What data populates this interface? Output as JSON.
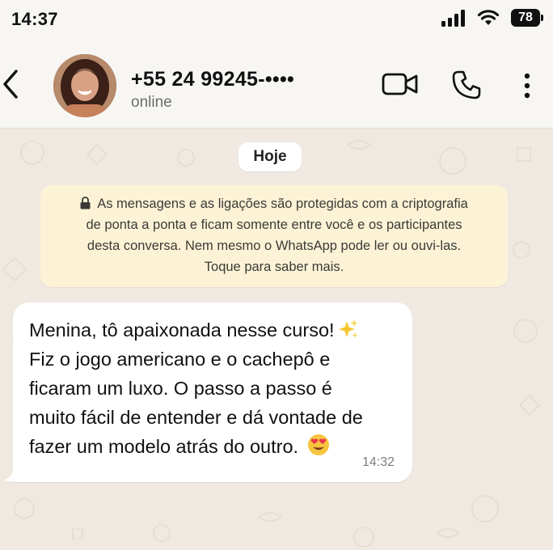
{
  "status_bar": {
    "time": "14:37",
    "battery": "78",
    "icons": [
      "signal-icon",
      "wifi-icon",
      "battery-icon"
    ]
  },
  "header": {
    "contact_name": "+55 24 99245-••••",
    "contact_status": "online",
    "icons": [
      "back-chevron-icon",
      "video-call-icon",
      "phone-call-icon",
      "more-vertical-icon"
    ]
  },
  "chat": {
    "day_label": "Hoje",
    "encryption_notice": {
      "lines": [
        "As mensagens e as ligações são protegidas com a criptografia",
        "de ponta a ponta e ficam somente entre você e os participantes",
        "desta conversa. Nem mesmo o WhatsApp pode ler ou ouvi-las.",
        "Toque para saber mais."
      ]
    },
    "messages": [
      {
        "lines": [
          "Menina, tô apaixonada nesse curso!",
          "Fiz o jogo americano e o cachepô e",
          "ficaram um luxo. O passo a passo é",
          "muito fácil de entender e dá vontade de",
          "fazer um modelo atrás do outro."
        ],
        "emojis": [
          "sparkles-emoji",
          "heart-eyes-emoji"
        ],
        "time": "14:32"
      }
    ]
  },
  "colors": {
    "chat_background": "#efe9e1",
    "header_background": "#f7f6f3",
    "notice_background": "#fcf3d6",
    "bubble_background": "#ffffff"
  }
}
